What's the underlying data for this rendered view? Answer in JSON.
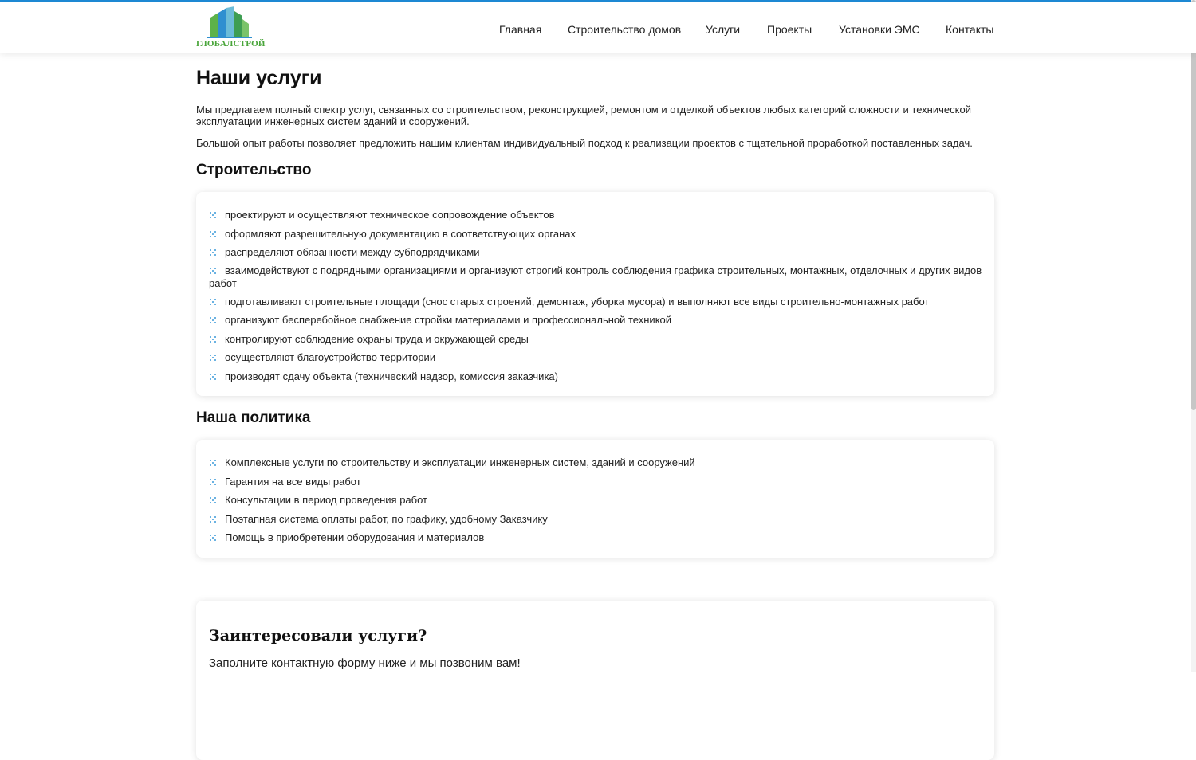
{
  "header": {
    "logo_text": "ГЛОБАЛСТРОЙ",
    "nav": [
      {
        "label": "Главная"
      },
      {
        "label": "Строительство домов"
      },
      {
        "label": "Услуги"
      },
      {
        "label": "Проекты"
      },
      {
        "label": "Установки ЭМС"
      },
      {
        "label": "Контакты"
      }
    ]
  },
  "page": {
    "title": "Наши услуги",
    "intro": [
      "Мы предлагаем полный спектр услуг, связанных со строительством, реконструкцией, ремонтом и отделкой объектов любых категорий сложности и технической эксплуатации инженерных систем зданий и сооружений.",
      "Большой опыт работы позволяет предложить нашим клиентам индивидуальный подход к реализации проектов с тщательной проработкой поставленных задач."
    ]
  },
  "construction": {
    "title": "Строительство",
    "items": [
      "проектируют и осуществляют техническое сопровождение объектов",
      "оформляют разрешительную документацию в соответствующих органах",
      "распределяют обязанности между субподрядчиками",
      "взаимодействуют с подрядными организациями и организуют строгий контроль соблюдения графика строительных, монтажных, отделочных и других видов работ",
      "подготавливают строительные площади (снос старых строений, демонтаж, уборка мусора) и выполняют все виды строительно-монтажных работ",
      "организуют бесперебойное снабжение стройки материалами и профессиональной техникой",
      "контролируют соблюдение охраны труда и окружающей среды",
      "осуществляют благоустройство территории",
      "производят сдачу объекта (технический надзор, комиссия заказчика)"
    ]
  },
  "policy": {
    "title": "Наша политика",
    "items": [
      "Комплексные услуги по строительству и эксплуатации инженерных систем, зданий и сооружений",
      "Гарантия на все виды работ",
      "Консультации в период проведения работ",
      "Поэтапная система оплаты работ, по графику, удобному Заказчику",
      "Помощь в приобретении оборудования и материалов"
    ]
  },
  "cta": {
    "title": "Заинтересовали услуги?",
    "text": "Заполните контактную форму ниже и мы позвоним вам!"
  },
  "colors": {
    "accent": "#1e8ad6",
    "bullet": "#3a9ad9",
    "logo_green": "#49a53a"
  },
  "icons": {
    "bullet": "dotted-grid-icon",
    "logo": "building-logo-icon"
  }
}
